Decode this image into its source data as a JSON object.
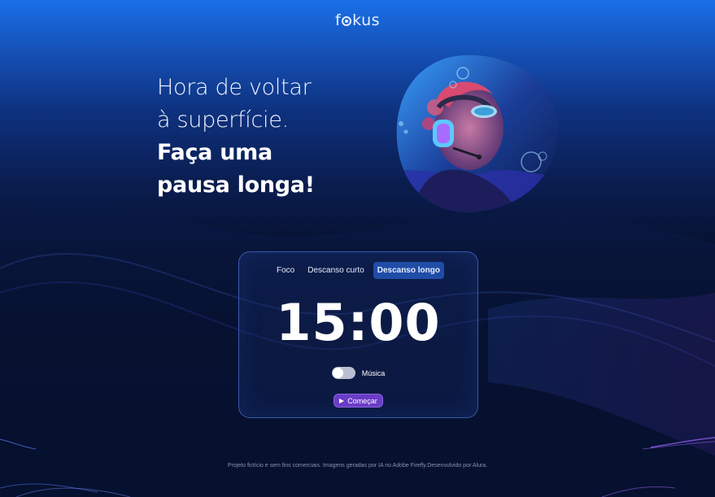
{
  "header": {
    "logo_text": "fokus"
  },
  "headline": {
    "line1": "Hora de voltar",
    "line2": "à superfície.",
    "line3": "Faça uma",
    "line4": "pausa longa!"
  },
  "card": {
    "tabs": [
      {
        "label": "Foco",
        "active": false
      },
      {
        "label": "Descanso curto",
        "active": false
      },
      {
        "label": "Descanso longo",
        "active": true
      }
    ],
    "timer": "15:00",
    "music_label": "Música",
    "music_on": false,
    "start_label": "Começar"
  },
  "footer": {
    "text": "Projeto fictício e sem fins comerciais. Imagens geradas por IA no Adobe Firefly.Desenvolvido por Alura."
  },
  "colors": {
    "accent": "#1f4da6",
    "button": "#6a3cc7",
    "background_top": "#1a6fe8",
    "background_bottom": "#03081a"
  }
}
